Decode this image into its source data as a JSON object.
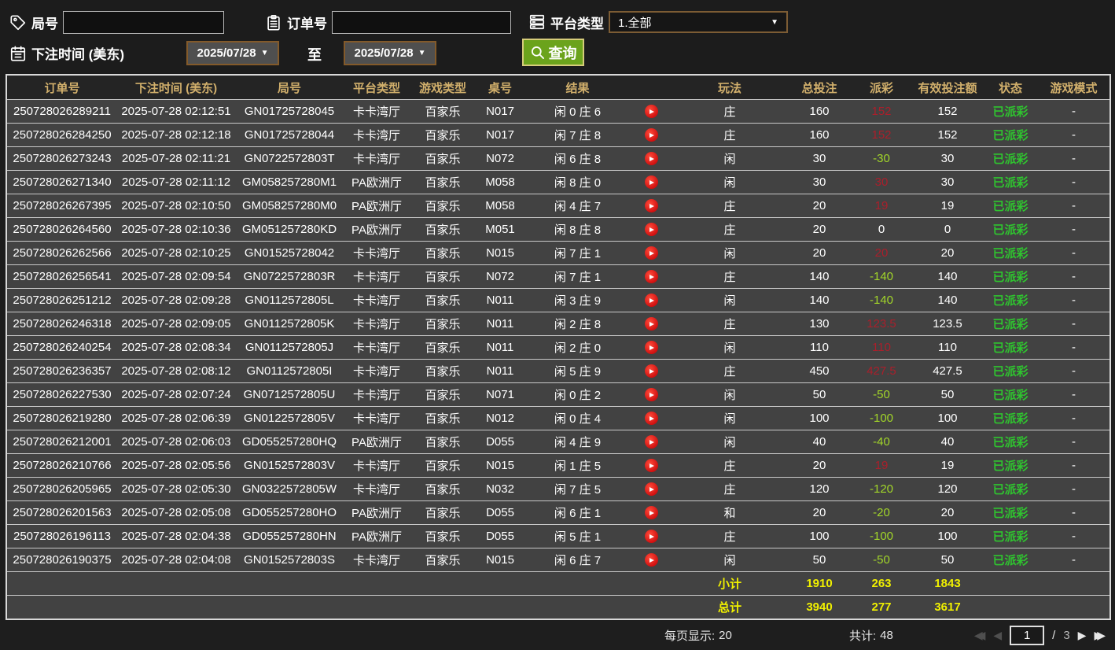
{
  "filters": {
    "game_no_label": "局号",
    "order_no_label": "订单号",
    "platform_label": "平台类型",
    "platform_value": "1.全部",
    "bet_time_label": "下注时间 (美东)",
    "date_from": "2025/07/28",
    "date_to": "2025/07/28",
    "to_label": "至",
    "query_label": "查询"
  },
  "icons": {
    "game_no": "tag-icon",
    "order_no": "clipboard-icon",
    "platform": "server-stack-icon",
    "bet_time": "calendar-icon",
    "query": "magnifier-icon",
    "row_action": "play-video-icon"
  },
  "colors": {
    "header_text": "#d2b06c",
    "row_bg": "#424242",
    "win_red": "#aa1f2b",
    "loss_green": "#a2d629",
    "status_green": "#2fc42f",
    "summary_yellow": "#f0f000",
    "query_green": "#6ba31c",
    "date_border": "#835a2a"
  },
  "table": {
    "headers": [
      "订单号",
      "下注时间 (美东)",
      "局号",
      "平台类型",
      "游戏类型",
      "桌号",
      "结果",
      "",
      "玩法",
      "总投注",
      "派彩",
      "有效投注额",
      "状态",
      "游戏模式"
    ],
    "rows": [
      {
        "order_no": "250728026289211",
        "bet_time": "2025-07-28 02:12:51",
        "game_no": "GN01725728045",
        "platform": "卡卡湾厅",
        "game_type": "百家乐",
        "table_no": "N017",
        "result": "闲 0 庄 6",
        "play": "庄",
        "total_bet": "160",
        "payout": "152",
        "payout_class": "win",
        "valid_bet": "152",
        "status": "已派彩",
        "game_mode": "-"
      },
      {
        "order_no": "250728026284250",
        "bet_time": "2025-07-28 02:12:18",
        "game_no": "GN01725728044",
        "platform": "卡卡湾厅",
        "game_type": "百家乐",
        "table_no": "N017",
        "result": "闲 7 庄 8",
        "play": "庄",
        "total_bet": "160",
        "payout": "152",
        "payout_class": "win",
        "valid_bet": "152",
        "status": "已派彩",
        "game_mode": "-"
      },
      {
        "order_no": "250728026273243",
        "bet_time": "2025-07-28 02:11:21",
        "game_no": "GN0722572803T",
        "platform": "卡卡湾厅",
        "game_type": "百家乐",
        "table_no": "N072",
        "result": "闲 6 庄 8",
        "play": "闲",
        "total_bet": "30",
        "payout": "-30",
        "payout_class": "loss",
        "valid_bet": "30",
        "status": "已派彩",
        "game_mode": "-"
      },
      {
        "order_no": "250728026271340",
        "bet_time": "2025-07-28 02:11:12",
        "game_no": "GM058257280M1",
        "platform": "PA欧洲厅",
        "game_type": "百家乐",
        "table_no": "M058",
        "result": "闲 8 庄 0",
        "play": "闲",
        "total_bet": "30",
        "payout": "30",
        "payout_class": "win",
        "valid_bet": "30",
        "status": "已派彩",
        "game_mode": "-"
      },
      {
        "order_no": "250728026267395",
        "bet_time": "2025-07-28 02:10:50",
        "game_no": "GM058257280M0",
        "platform": "PA欧洲厅",
        "game_type": "百家乐",
        "table_no": "M058",
        "result": "闲 4 庄 7",
        "play": "庄",
        "total_bet": "20",
        "payout": "19",
        "payout_class": "win",
        "valid_bet": "19",
        "status": "已派彩",
        "game_mode": "-"
      },
      {
        "order_no": "250728026264560",
        "bet_time": "2025-07-28 02:10:36",
        "game_no": "GM051257280KD",
        "platform": "PA欧洲厅",
        "game_type": "百家乐",
        "table_no": "M051",
        "result": "闲 8 庄 8",
        "play": "庄",
        "total_bet": "20",
        "payout": "0",
        "payout_class": "zero",
        "valid_bet": "0",
        "status": "已派彩",
        "game_mode": "-"
      },
      {
        "order_no": "250728026262566",
        "bet_time": "2025-07-28 02:10:25",
        "game_no": "GN01525728042",
        "platform": "卡卡湾厅",
        "game_type": "百家乐",
        "table_no": "N015",
        "result": "闲 7 庄 1",
        "play": "闲",
        "total_bet": "20",
        "payout": "20",
        "payout_class": "win",
        "valid_bet": "20",
        "status": "已派彩",
        "game_mode": "-"
      },
      {
        "order_no": "250728026256541",
        "bet_time": "2025-07-28 02:09:54",
        "game_no": "GN0722572803R",
        "platform": "卡卡湾厅",
        "game_type": "百家乐",
        "table_no": "N072",
        "result": "闲 7 庄 1",
        "play": "庄",
        "total_bet": "140",
        "payout": "-140",
        "payout_class": "loss",
        "valid_bet": "140",
        "status": "已派彩",
        "game_mode": "-"
      },
      {
        "order_no": "250728026251212",
        "bet_time": "2025-07-28 02:09:28",
        "game_no": "GN0112572805L",
        "platform": "卡卡湾厅",
        "game_type": "百家乐",
        "table_no": "N011",
        "result": "闲 3 庄 9",
        "play": "闲",
        "total_bet": "140",
        "payout": "-140",
        "payout_class": "loss",
        "valid_bet": "140",
        "status": "已派彩",
        "game_mode": "-"
      },
      {
        "order_no": "250728026246318",
        "bet_time": "2025-07-28 02:09:05",
        "game_no": "GN0112572805K",
        "platform": "卡卡湾厅",
        "game_type": "百家乐",
        "table_no": "N011",
        "result": "闲 2 庄 8",
        "play": "庄",
        "total_bet": "130",
        "payout": "123.5",
        "payout_class": "win",
        "valid_bet": "123.5",
        "status": "已派彩",
        "game_mode": "-"
      },
      {
        "order_no": "250728026240254",
        "bet_time": "2025-07-28 02:08:34",
        "game_no": "GN0112572805J",
        "platform": "卡卡湾厅",
        "game_type": "百家乐",
        "table_no": "N011",
        "result": "闲 2 庄 0",
        "play": "闲",
        "total_bet": "110",
        "payout": "110",
        "payout_class": "win",
        "valid_bet": "110",
        "status": "已派彩",
        "game_mode": "-"
      },
      {
        "order_no": "250728026236357",
        "bet_time": "2025-07-28 02:08:12",
        "game_no": "GN0112572805I",
        "platform": "卡卡湾厅",
        "game_type": "百家乐",
        "table_no": "N011",
        "result": "闲 5 庄 9",
        "play": "庄",
        "total_bet": "450",
        "payout": "427.5",
        "payout_class": "win",
        "valid_bet": "427.5",
        "status": "已派彩",
        "game_mode": "-"
      },
      {
        "order_no": "250728026227530",
        "bet_time": "2025-07-28 02:07:24",
        "game_no": "GN0712572805U",
        "platform": "卡卡湾厅",
        "game_type": "百家乐",
        "table_no": "N071",
        "result": "闲 0 庄 2",
        "play": "闲",
        "total_bet": "50",
        "payout": "-50",
        "payout_class": "loss",
        "valid_bet": "50",
        "status": "已派彩",
        "game_mode": "-"
      },
      {
        "order_no": "250728026219280",
        "bet_time": "2025-07-28 02:06:39",
        "game_no": "GN0122572805V",
        "platform": "卡卡湾厅",
        "game_type": "百家乐",
        "table_no": "N012",
        "result": "闲 0 庄 4",
        "play": "闲",
        "total_bet": "100",
        "payout": "-100",
        "payout_class": "loss",
        "valid_bet": "100",
        "status": "已派彩",
        "game_mode": "-"
      },
      {
        "order_no": "250728026212001",
        "bet_time": "2025-07-28 02:06:03",
        "game_no": "GD055257280HQ",
        "platform": "PA欧洲厅",
        "game_type": "百家乐",
        "table_no": "D055",
        "result": "闲 4 庄 9",
        "play": "闲",
        "total_bet": "40",
        "payout": "-40",
        "payout_class": "loss",
        "valid_bet": "40",
        "status": "已派彩",
        "game_mode": "-"
      },
      {
        "order_no": "250728026210766",
        "bet_time": "2025-07-28 02:05:56",
        "game_no": "GN0152572803V",
        "platform": "卡卡湾厅",
        "game_type": "百家乐",
        "table_no": "N015",
        "result": "闲 1 庄 5",
        "play": "庄",
        "total_bet": "20",
        "payout": "19",
        "payout_class": "win",
        "valid_bet": "19",
        "status": "已派彩",
        "game_mode": "-"
      },
      {
        "order_no": "250728026205965",
        "bet_time": "2025-07-28 02:05:30",
        "game_no": "GN0322572805W",
        "platform": "卡卡湾厅",
        "game_type": "百家乐",
        "table_no": "N032",
        "result": "闲 7 庄 5",
        "play": "庄",
        "total_bet": "120",
        "payout": "-120",
        "payout_class": "loss",
        "valid_bet": "120",
        "status": "已派彩",
        "game_mode": "-"
      },
      {
        "order_no": "250728026201563",
        "bet_time": "2025-07-28 02:05:08",
        "game_no": "GD055257280HO",
        "platform": "PA欧洲厅",
        "game_type": "百家乐",
        "table_no": "D055",
        "result": "闲 6 庄 1",
        "play": "和",
        "total_bet": "20",
        "payout": "-20",
        "payout_class": "loss",
        "valid_bet": "20",
        "status": "已派彩",
        "game_mode": "-"
      },
      {
        "order_no": "250728026196113",
        "bet_time": "2025-07-28 02:04:38",
        "game_no": "GD055257280HN",
        "platform": "PA欧洲厅",
        "game_type": "百家乐",
        "table_no": "D055",
        "result": "闲 5 庄 1",
        "play": "庄",
        "total_bet": "100",
        "payout": "-100",
        "payout_class": "loss",
        "valid_bet": "100",
        "status": "已派彩",
        "game_mode": "-"
      },
      {
        "order_no": "250728026190375",
        "bet_time": "2025-07-28 02:04:08",
        "game_no": "GN0152572803S",
        "platform": "卡卡湾厅",
        "game_type": "百家乐",
        "table_no": "N015",
        "result": "闲 6 庄 7",
        "play": "闲",
        "total_bet": "50",
        "payout": "-50",
        "payout_class": "loss",
        "valid_bet": "50",
        "status": "已派彩",
        "game_mode": "-"
      }
    ],
    "subtotal": {
      "label": "小计",
      "total_bet": "1910",
      "payout": "263",
      "valid_bet": "1843"
    },
    "total": {
      "label": "总计",
      "total_bet": "3940",
      "payout": "277",
      "valid_bet": "3617"
    }
  },
  "footer": {
    "per_page_label": "每页显示:",
    "per_page_value": "20",
    "total_count_label": "共计:",
    "total_count_value": "48",
    "page_current": "1",
    "page_separator": "/",
    "page_total": "3"
  }
}
